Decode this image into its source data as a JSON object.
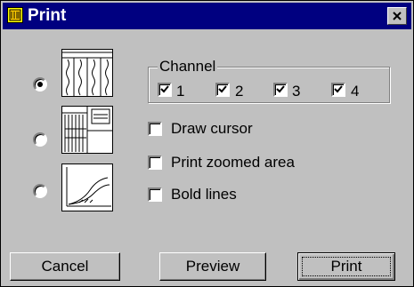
{
  "window": {
    "title": "Print"
  },
  "layout_options": [
    {
      "name": "full-channels",
      "selected": true
    },
    {
      "name": "channels-with-zoom",
      "selected": false
    },
    {
      "name": "curve",
      "selected": false
    }
  ],
  "channel_group": {
    "legend": "Channel",
    "channels": [
      {
        "label": "1",
        "checked": true
      },
      {
        "label": "2",
        "checked": true
      },
      {
        "label": "3",
        "checked": true
      },
      {
        "label": "4",
        "checked": true
      }
    ]
  },
  "options": [
    {
      "label": "Draw cursor",
      "checked": false
    },
    {
      "label": "Print zoomed area",
      "checked": false
    },
    {
      "label": "Bold lines",
      "checked": false
    }
  ],
  "buttons": {
    "cancel": "Cancel",
    "preview": "Preview",
    "print": "Print"
  },
  "colors": {
    "titlebar": "#000080",
    "face": "#c0c0c0"
  }
}
